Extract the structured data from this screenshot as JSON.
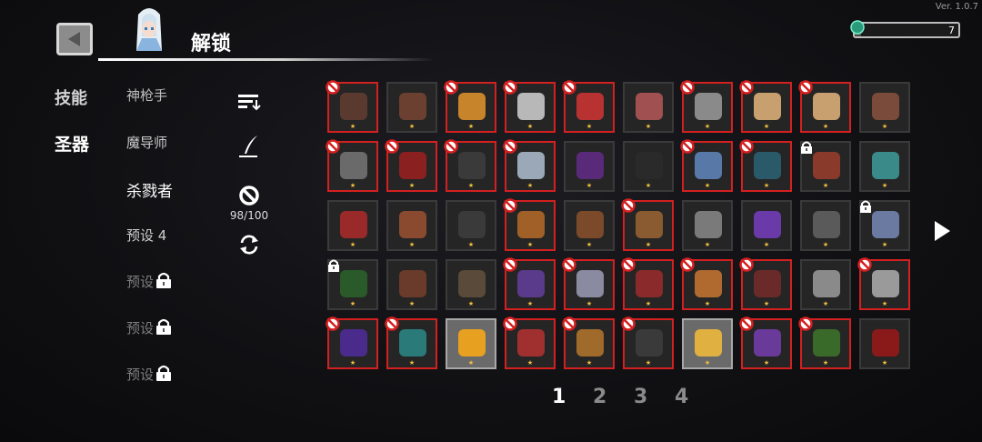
{
  "version": "Ver. 1.0.7",
  "header": {
    "title": "解锁"
  },
  "currency": {
    "value": "7",
    "fill": 0.06
  },
  "tabs": [
    {
      "label": "技能",
      "active": false
    },
    {
      "label": "圣器",
      "active": true
    }
  ],
  "classes": [
    {
      "label": "神枪手",
      "locked": false
    },
    {
      "label": "魔导师",
      "locked": false
    },
    {
      "label": "杀戮者",
      "locked": false,
      "selected": true
    },
    {
      "label": "预设 4",
      "locked": false
    },
    {
      "label": "预设",
      "locked": true
    },
    {
      "label": "预设",
      "locked": true
    },
    {
      "label": "预设",
      "locked": true
    }
  ],
  "tools": {
    "sort_icon": "sort-icon",
    "edit_icon": "quill-icon",
    "ban_icon": "ban-icon",
    "ban_count": "98/100",
    "reset_icon": "refresh-icon"
  },
  "grid": {
    "colors": [
      "#5a3a2e",
      "#6b4030",
      "#c8842a",
      "#b8b8b8",
      "#b83232",
      "#a05050",
      "#8a8a8a",
      "#c8a070",
      "#c8a070",
      "#7a4a3a",
      "#6a6a6a",
      "#8a2020",
      "#3a3a3a",
      "#9aa8b8",
      "#5a2a7a",
      "#2a2a2a",
      "#5878a8",
      "#2a5a6a",
      "#8a3a2a",
      "#3a8a8a",
      "#9a2a2a",
      "#8a4a30",
      "#3a3a3a",
      "#a06028",
      "#7a4a2a",
      "#8a5a30",
      "#7a7a7a",
      "#6a3aa8",
      "#5a5a5a",
      "#6a7aa0",
      "#2a5a2a",
      "#6a3a2a",
      "#5a4a3a",
      "#5a3a8a",
      "#8a8aa0",
      "#8a2a2a",
      "#b06a30",
      "#6a2a2a",
      "#8a8a8a",
      "#9a9a9a",
      "#4a2a8a",
      "#2a7a7a",
      "#e8a020",
      "#a03030",
      "#a06a2a",
      "#3a3a3a",
      "#e0b040",
      "#6a3a9a",
      "#3a6a2a",
      "#8a1a1a"
    ],
    "banned": [
      0,
      2,
      3,
      4,
      6,
      7,
      8,
      10,
      11,
      12,
      13,
      16,
      17,
      23,
      25,
      33,
      34,
      35,
      36,
      37,
      39,
      40,
      41,
      43,
      44,
      45,
      47,
      48
    ],
    "locked": [
      18,
      29,
      30
    ],
    "selected": [
      42,
      46
    ]
  },
  "pages": [
    "1",
    "2",
    "3",
    "4"
  ],
  "active_page": 0
}
